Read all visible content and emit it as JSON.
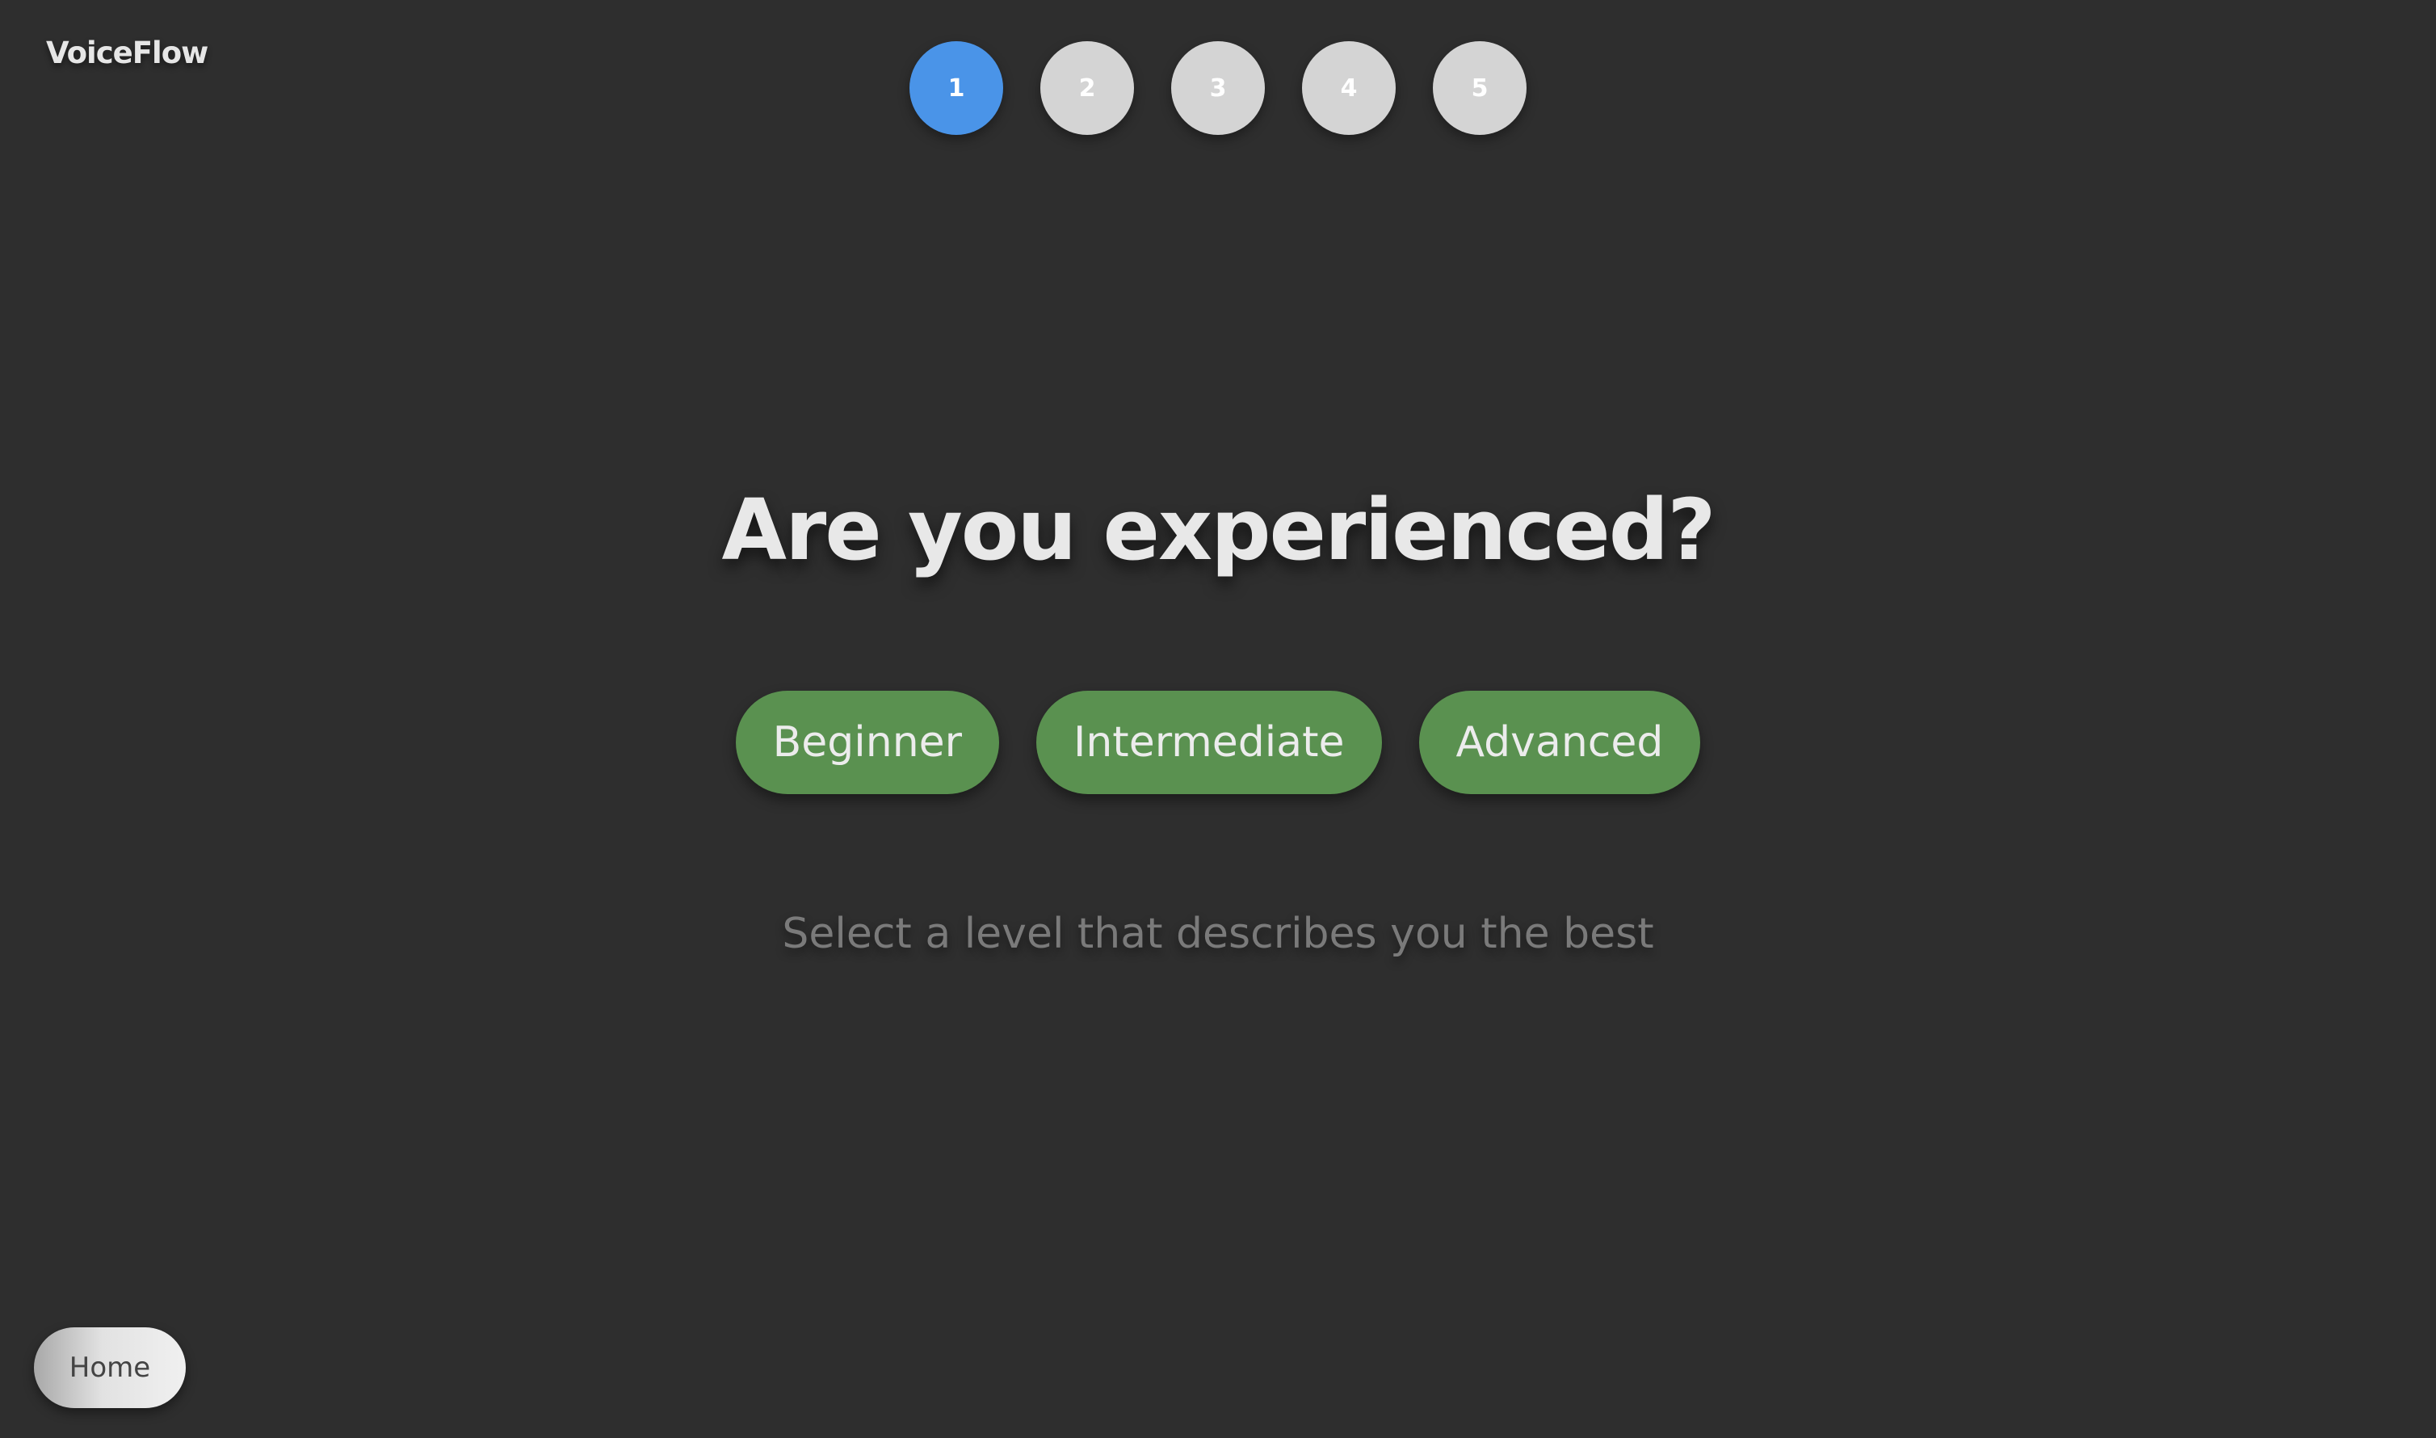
{
  "app": {
    "brand": "VoiceFlow"
  },
  "steps": {
    "current": 1,
    "items": [
      "1",
      "2",
      "3",
      "4",
      "5"
    ],
    "active_color": "#4a94e8",
    "inactive_color": "#d4d4d4"
  },
  "main": {
    "title": "Are you experienced?",
    "options": [
      "Beginner",
      "Intermediate",
      "Advanced"
    ],
    "option_color": "#5a9150",
    "hint": "Select a level that describes you the best"
  },
  "footer": {
    "home_label": "Home"
  }
}
